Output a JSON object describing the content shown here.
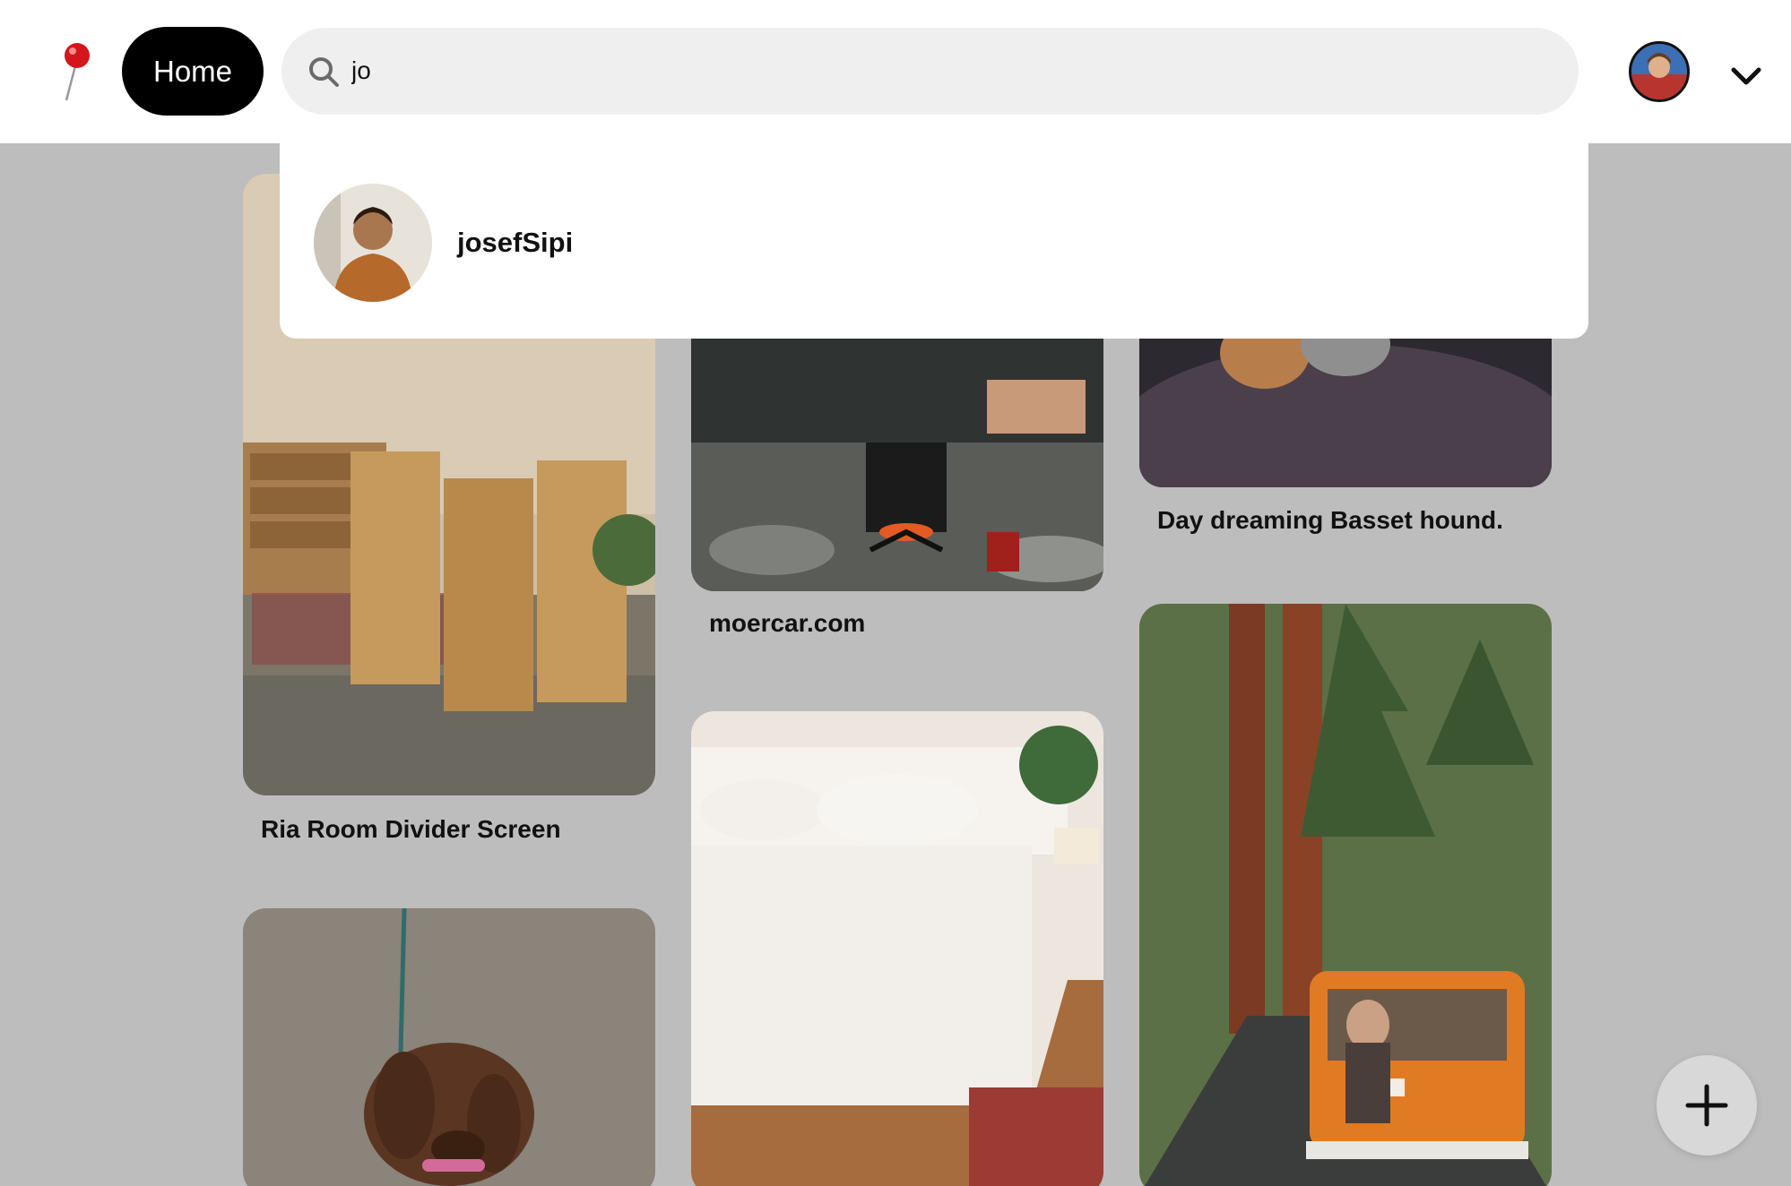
{
  "header": {
    "logo_icon": "red-pushpin-icon",
    "home_label": "Home",
    "search_value": "jo",
    "avatar_icon": "user-avatar",
    "menu_icon": "chevron-down-icon"
  },
  "search_results": [
    {
      "name": "josefSipi"
    }
  ],
  "pins": [
    {
      "title": "Ria Room Divider Screen"
    },
    {
      "title": "moercar.com"
    },
    {
      "title": "Day dreaming Basset hound."
    }
  ],
  "fab": {
    "icon": "plus-icon"
  }
}
